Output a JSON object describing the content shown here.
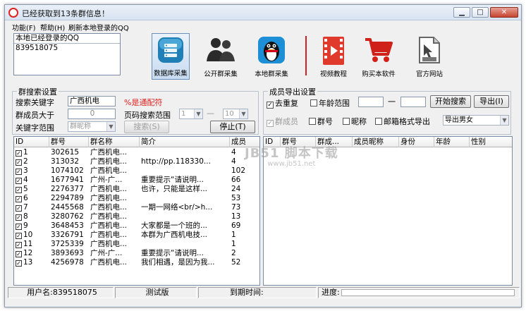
{
  "window": {
    "title": "已经获取到13条群信息！",
    "minimize": "▁",
    "maximize": "□",
    "close": "✕"
  },
  "menu": [
    {
      "label": "功能(F)"
    },
    {
      "label": "帮助(H)"
    },
    {
      "label": "刷新本地登录的QQ"
    }
  ],
  "qq_box": {
    "header": "本地已经登录的QQ",
    "items": [
      "839518075"
    ]
  },
  "toolbar": [
    {
      "label": "数据库采集",
      "icon": "database-icon",
      "selected": true
    },
    {
      "label": "公开群采集",
      "icon": "users-icon",
      "selected": false
    },
    {
      "label": "本地群采集",
      "icon": "penguin-icon",
      "selected": false
    },
    {
      "label": "视频教程",
      "icon": "video-icon",
      "selected": false
    },
    {
      "label": "购买本软件",
      "icon": "cart-icon",
      "selected": false
    },
    {
      "label": "官方网站",
      "icon": "website-icon",
      "selected": false
    }
  ],
  "group_search": {
    "title": "群搜索设置",
    "keyword_label": "搜索关键字",
    "keyword_value": "广西机电",
    "fuzzy_note": "%是通配符",
    "members_label": "群成员大于",
    "members_value": "0",
    "page_range_label": "页码搜索范围",
    "page_from": "1",
    "page_to": "10",
    "scope_label": "关键字范围",
    "scope_value": "群昵称",
    "search_button": "搜索(S)",
    "stop_button": "停止(T)"
  },
  "member_export": {
    "title": "成员导出设置",
    "dedup_label": "去重复",
    "dedup_checked": true,
    "age_label": "年龄范围",
    "age_sep": "一",
    "start_button": "开始搜索",
    "export_button_top": "导出(I)",
    "group_member_label": "群成员",
    "group_no_label": "群号",
    "nickname_label": "昵称",
    "email_label": "邮箱格式导出",
    "gender_value": "导出男女"
  },
  "group_table": {
    "columns": [
      "ID",
      "群号",
      "群名称",
      "简介",
      "成员"
    ],
    "rows": [
      {
        "id": "1",
        "group_no": "302615",
        "name": "广西机电...",
        "intro": "",
        "members": "4"
      },
      {
        "id": "2",
        "group_no": "313032",
        "name": "广西机电...",
        "intro": "http://pp.118330...",
        "members": "4"
      },
      {
        "id": "3",
        "group_no": "1074102",
        "name": "广西机电...",
        "intro": "",
        "members": "102"
      },
      {
        "id": "4",
        "group_no": "1677941",
        "name": "广州-广...",
        "intro": "重要提示“请说明...",
        "members": "66"
      },
      {
        "id": "5",
        "group_no": "2276377",
        "name": "广西机电...",
        "intro": "也许，只能是这样...",
        "members": "24"
      },
      {
        "id": "6",
        "group_no": "2294789",
        "name": "广西机电...",
        "intro": "",
        "members": "53"
      },
      {
        "id": "7",
        "group_no": "2445568",
        "name": "广西机电...",
        "intro": "一期一网络<br/>h...",
        "members": "73"
      },
      {
        "id": "8",
        "group_no": "3280762",
        "name": "广西机电...",
        "intro": "",
        "members": "13"
      },
      {
        "id": "9",
        "group_no": "3648453",
        "name": "广西机电...",
        "intro": "大家都是一个班的...",
        "members": "69"
      },
      {
        "id": "10",
        "group_no": "3326791",
        "name": "广西机电...",
        "intro": "本群为广西机电技...",
        "members": "1"
      },
      {
        "id": "11",
        "group_no": "3725339",
        "name": "广西机电...",
        "intro": "",
        "members": "1"
      },
      {
        "id": "12",
        "group_no": "3893693",
        "name": "广州-广...",
        "intro": "重要提示“请说明...",
        "members": "2"
      },
      {
        "id": "13",
        "group_no": "4256978",
        "name": "广西机电...",
        "intro": "我们相遇，是因为我...",
        "members": "52"
      }
    ]
  },
  "member_table": {
    "columns": [
      "ID",
      "群号",
      "群成...",
      "成员昵称",
      "身份",
      "年龄",
      "性别"
    ]
  },
  "watermark": {
    "text": "JB51 脚本下载",
    "sub": "www.jb51.net"
  },
  "status": {
    "username": "用户名:839518075",
    "edition": "测试版",
    "expire": "到期时间:",
    "progress": "进度:",
    "progress_value": 0
  }
}
